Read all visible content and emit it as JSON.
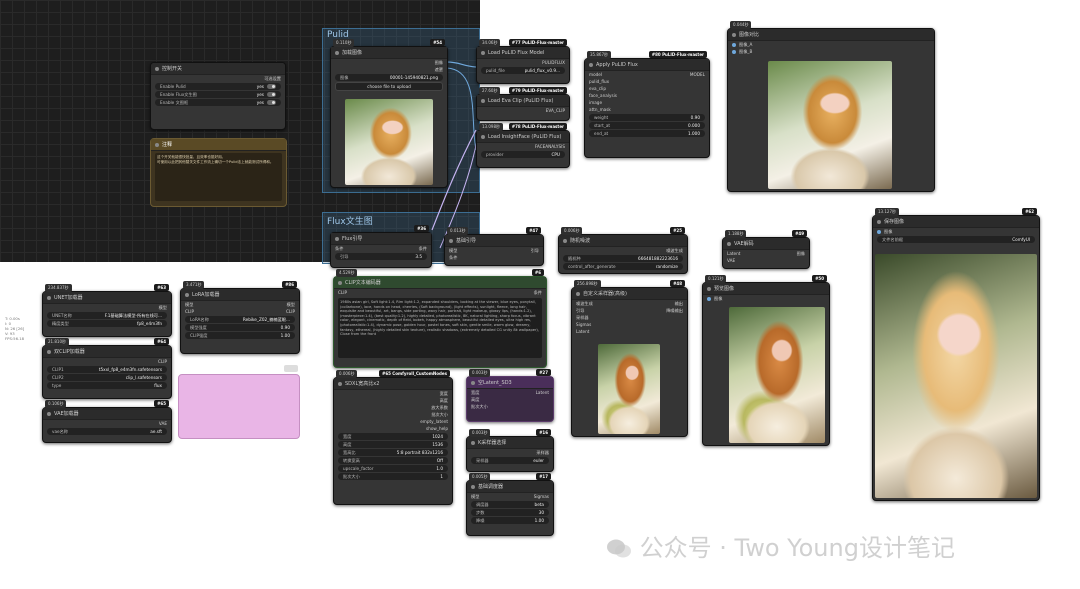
{
  "groups": {
    "pulid": "Pulid",
    "flux": "Flux文生图"
  },
  "nodes": {
    "control": {
      "title": "控制开关",
      "header_right": "可选设置",
      "rows": [
        {
          "label": "Enable Pulid",
          "value": "yes"
        },
        {
          "label": "Enable Flux文生图",
          "value": "yes"
        },
        {
          "label": "Enable 文图框",
          "value": "yes"
        }
      ]
    },
    "note": {
      "title": "注释",
      "text": "这个开关就能很快批量，且效率也挺好用。\n可使用以此把其他替关文件工作流上确切一个Pulid法上就能测试所得和。"
    },
    "load_image": {
      "timestamp": "0.110秒",
      "badge": "#54",
      "title": "加载图像",
      "out1": "图像",
      "out2": "遮罩",
      "filename_label": "图像",
      "filename": "00001-145940821.png",
      "upload": "choose file to upload"
    },
    "pulid_model": {
      "timestamp": "34.06秒",
      "badge": "#77 PuLID-Flux-master",
      "title": "Load PuLID Flux Model",
      "out": "PULIDFLUX",
      "file_label": "pulid_file",
      "file_value": "pulid_flux_v0.9..."
    },
    "eva_clip": {
      "timestamp": "27.60秒",
      "badge": "#79 PuLID-Flux-master",
      "title": "Load Eva Clip (PuLID Flux)",
      "out": "EVA_CLIP"
    },
    "insightface": {
      "timestamp": "13.098秒",
      "badge": "#78 PuLID-Flux-master",
      "title": "Load InsightFace (PuLID Flux)",
      "out": "FACEANALYSIS",
      "provider_label": "provider",
      "provider_value": "CPU"
    },
    "apply_pulid": {
      "timestamp": "35.867秒",
      "badge": "#80 PuLID-Flux-master",
      "title": "Apply PuLID Flux",
      "inputs": [
        "model",
        "pulid_flux",
        "eva_clip",
        "face_analysis",
        "image",
        "attn_mask"
      ],
      "out": "MODEL",
      "widgets": [
        {
          "label": "weight",
          "value": "0.90"
        },
        {
          "label": "start_at",
          "value": "0.000"
        },
        {
          "label": "end_at",
          "value": "1.000"
        }
      ]
    },
    "compare": {
      "timestamp": "0.044秒",
      "title": "图像对比",
      "inputs": [
        "图像_A",
        "图像_B"
      ]
    },
    "flux_guidance": {
      "badge": "#36",
      "title": "Flux引导",
      "in": "条件",
      "out": "条件",
      "widget_label": "引导",
      "widget_value": "3.5"
    },
    "basic_guider": {
      "timestamp": "0.013秒",
      "badge": "#47",
      "title": "基础引导",
      "inputs": [
        "模型",
        "条件"
      ],
      "out": "引导"
    },
    "random_noise": {
      "timestamp": "0.006秒",
      "badge": "#25",
      "title": "随机噪波",
      "out": "噪波生成",
      "widgets": [
        {
          "label": "随机种",
          "value": "666481882223616"
        },
        {
          "label": "control_after_generate",
          "value": "randomize"
        }
      ]
    },
    "vae_decode": {
      "timestamp": "1.188秒",
      "badge": "#49",
      "title": "VAE解码",
      "inputs": [
        "Latent",
        "VAE"
      ],
      "out": "图像"
    },
    "save_image": {
      "timestamp": "13.127秒",
      "badge": "#62",
      "title": "保存图像",
      "in": "图像",
      "widget_label": "文件名前缀",
      "widget_value": "ComfyUI"
    },
    "unet_loader": {
      "timestamp": "234.837秒",
      "badge": "#63",
      "title": "UNET加载器",
      "out": "模型",
      "widgets": [
        {
          "label": "UNET名称",
          "value": "F.1基础算法模型-所有在线可..."
        },
        {
          "label": "精度类型",
          "value": "fp8_e4m3fn"
        }
      ]
    },
    "lora_loader": {
      "timestamp": "3.471秒",
      "badge": "#86",
      "title": "LoRA加载器",
      "inputs": [
        "模型",
        "CLIP"
      ],
      "outs": [
        "模型",
        "CLIP"
      ],
      "widgets": [
        {
          "label": "LoRA名称",
          "value": "Rebike_Z02_楠楠蓝眼..."
        },
        {
          "label": "模型强度",
          "value": "0.90"
        },
        {
          "label": "CLIP强度",
          "value": "1.00"
        }
      ]
    },
    "clip_text": {
      "timestamp": "4.529秒",
      "badge": "#6",
      "title": "CLIP文本编码器",
      "in": "CLIP",
      "out": "条件",
      "text": "1980s asian girl, Soft light:1.4, Rim light:1.2, expanded shoulders, looking at the viewer, blue eyes, ponytail, (collarbone), lace, hands on head, cherries, (Soft background), (light effects), sunlight, fleece, long hair, exquisite and beautiful, art, bangs, side parting, wavy hair, portrait, light makeup, glossy lips, (hands:1.2), (masterpiece:1.4), (best quality:1.2), highly detailed, photorealistic, 8K, natural lighting, sharp focus, vibrant color, elegant, cinematic, depth of field, bokeh, happy atmosphere, beautiful detailed eyes, ultra high res, (photorealistic:1.4), dynamic pose, golden hour, pastel tones, soft skin, gentle smile, warm glow, dreamy, fantasy, ethereal, (highly detailed skin texture), realistic shadows, (extremely detailed CG unity 8k wallpaper), Close from the front"
    },
    "dual_clip": {
      "timestamp": "21.810秒",
      "badge": "#64",
      "title": "双CLIP加载器",
      "out": "CLIP",
      "widgets": [
        {
          "label": "CLIP1",
          "value": "t5xxl_fp8_e4m3fn.safetensors"
        },
        {
          "label": "CLIP2",
          "value": "clip_l.safetensors"
        },
        {
          "label": "type",
          "value": "flux"
        }
      ]
    },
    "vae_loader": {
      "timestamp": "0.106秒",
      "badge": "#65",
      "title": "VAE加载器",
      "out": "VAE",
      "widget_label": "vae名称",
      "widget_value": "ae.sft"
    },
    "sdxl_res": {
      "timestamp": "0.006秒",
      "badge": "#65 Comfyroll_CustomNodes",
      "title": "SDXL宽高比x2",
      "outs": [
        "宽度",
        "高度",
        "放大系数",
        "批次大小",
        "empty_latent",
        "show_help"
      ],
      "widgets": [
        {
          "label": "宽度",
          "value": "1024"
        },
        {
          "label": "高度",
          "value": "1536"
        },
        {
          "label": "宽高比",
          "value": "5:8 portrait 832x1216"
        },
        {
          "label": "转换宽高",
          "value": "Off"
        },
        {
          "label": "upscale_factor",
          "value": "1.0"
        },
        {
          "label": "批次大小",
          "value": "1"
        }
      ]
    },
    "empty_latent": {
      "timestamp": "0.003秒",
      "badge": "#27",
      "title": "空Latent_SD3",
      "inputs": [
        "宽度",
        "高度",
        "批次大小"
      ],
      "out": "Latent"
    },
    "ksampler_select": {
      "timestamp": "0.003秒",
      "badge": "#16",
      "title": "K采样器选择",
      "out": "采样器",
      "widget_label": "采样器",
      "widget_value": "euler"
    },
    "scheduler": {
      "timestamp": "0.005秒",
      "badge": "#17",
      "title": "基础调度器",
      "in": "模型",
      "out": "Sigmas",
      "widgets": [
        {
          "label": "调度器",
          "value": "beta"
        },
        {
          "label": "步数",
          "value": "30"
        },
        {
          "label": "降噪",
          "value": "1.00"
        }
      ]
    },
    "custom_sampler": {
      "timestamp": "256.898秒",
      "badge": "#48",
      "title": "自定义采样器(高级)",
      "inputs": [
        "噪波生成",
        "引导",
        "采样器",
        "Sigmas",
        "Latent"
      ],
      "outs": [
        "输出",
        "降噪输出"
      ]
    },
    "preview": {
      "timestamp": "0.121秒",
      "badge": "#50",
      "title": "预览图像",
      "in": "图像"
    }
  },
  "side_text": [
    "T: 0.00s",
    "I: 0",
    "N: 26 [26]",
    "V: 93",
    "FPS:56.18"
  ],
  "watermark": "公众号 · Two Young设计笔记"
}
